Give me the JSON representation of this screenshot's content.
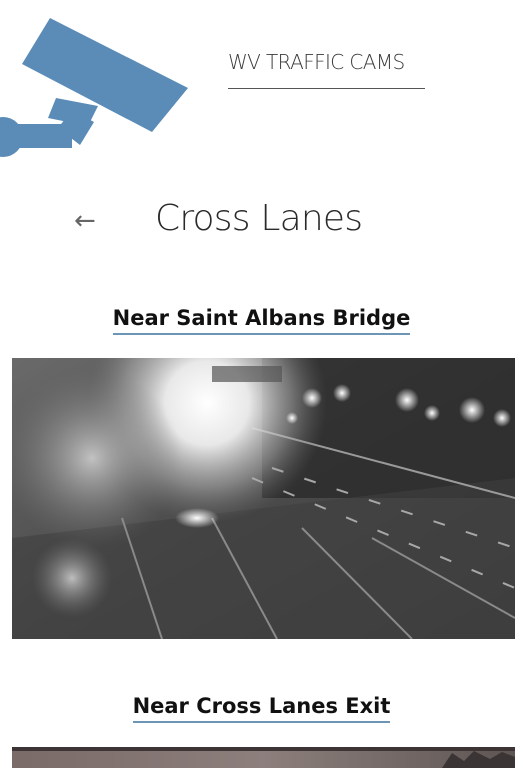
{
  "header": {
    "app_title": "WV TRAFFIC CAMS",
    "logo_icon": "security-camera-icon",
    "logo_color": "#5b8cb8"
  },
  "nav": {
    "back_icon": "arrow-left-icon",
    "back_glyph": "←"
  },
  "page": {
    "title": "Cross Lanes"
  },
  "cameras": [
    {
      "title": "Near Saint Albans Bridge"
    },
    {
      "title": "Near Cross Lanes Exit"
    }
  ],
  "colors": {
    "underline": "#6d95b6",
    "background": "#ffffff"
  }
}
